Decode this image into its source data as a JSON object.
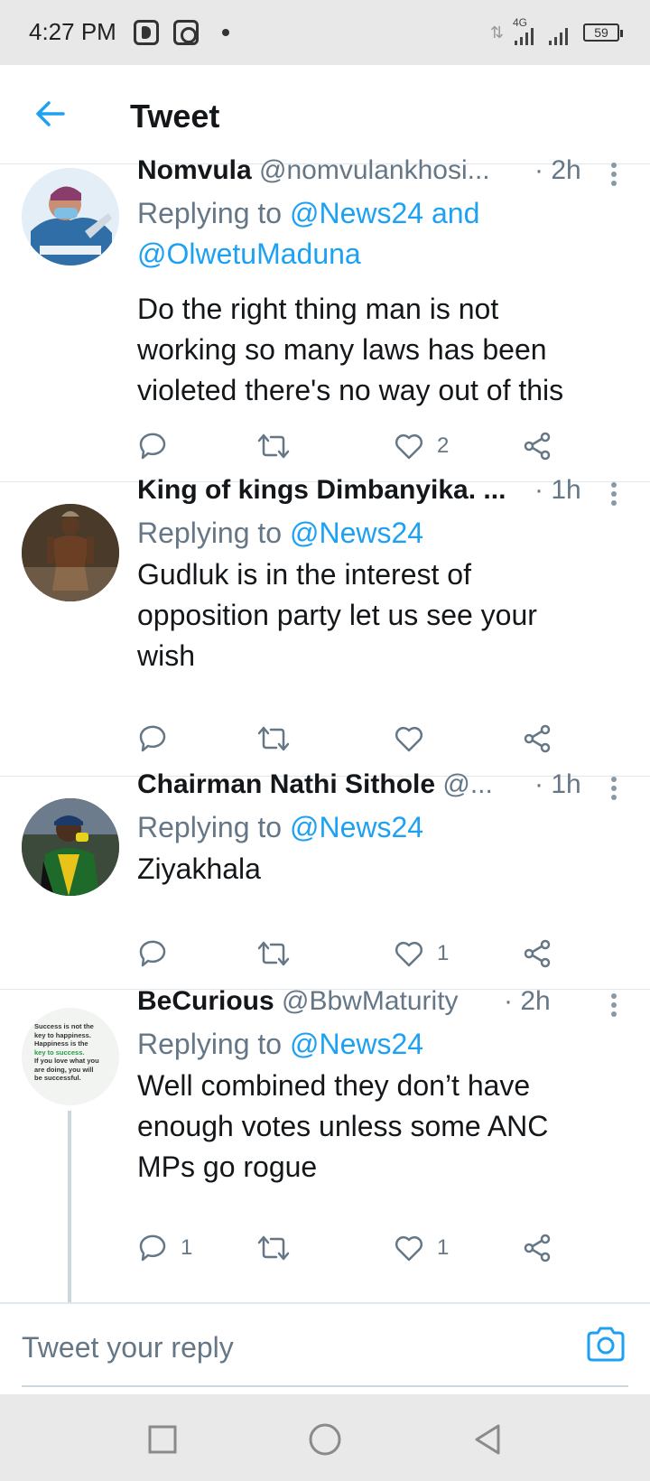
{
  "status_bar": {
    "time": "4:27 PM",
    "network": "4G",
    "battery": "59"
  },
  "header": {
    "title": "Tweet",
    "back_icon": "arrow-left-icon"
  },
  "colors": {
    "accent": "#1da1f2",
    "text_primary": "#14171a",
    "text_secondary": "#657786"
  },
  "tweets": [
    {
      "name": "Nomvula",
      "handle": "@nomvulankhosi...",
      "time": "· 2h",
      "replying_prefix": "Replying to",
      "replying_mentions": "@News24 and",
      "replying_mentions_2": "@OlwetuMaduna",
      "text_lines": [
        "Do the right thing man is not",
        "working so many laws has been",
        "violeted there's no way out of this"
      ],
      "reply_count": "",
      "retweet_count": "",
      "like_count": "2"
    },
    {
      "name": "King of kings Dimbanyika. ...",
      "handle": "",
      "time": "· 1h",
      "replying_prefix": "Replying to",
      "replying_mentions": "@News24",
      "text_lines": [
        "Gudluk is in the interest of",
        "opposition party let us see your",
        "wish"
      ],
      "reply_count": "",
      "retweet_count": "",
      "like_count": ""
    },
    {
      "name": "Chairman Nathi Sithole",
      "handle": "@...",
      "time": "· 1h",
      "replying_prefix": "Replying to",
      "replying_mentions": "@News24",
      "text_lines": [
        "Ziyakhala"
      ],
      "reply_count": "",
      "retweet_count": "",
      "like_count": "1"
    },
    {
      "name": "BeCurious",
      "handle": "@BbwMaturity",
      "time": "· 2h",
      "replying_prefix": "Replying to",
      "replying_mentions": "@News24",
      "text_lines": [
        "Well combined they don’t have",
        "enough votes unless some ANC",
        "MPs go rogue"
      ],
      "reply_count": "1",
      "retweet_count": "",
      "like_count": "1",
      "avatar_text": [
        "Success is not the",
        "key to happiness.",
        "Happiness is the",
        "key to success.",
        "If you love what you",
        "are doing, you will",
        "be successful."
      ]
    }
  ],
  "reply_bar": {
    "placeholder": "Tweet your reply",
    "camera_icon": "camera-icon"
  },
  "nav_bar": {
    "icons": [
      "recents-square-icon",
      "home-circle-icon",
      "back-triangle-icon"
    ]
  }
}
